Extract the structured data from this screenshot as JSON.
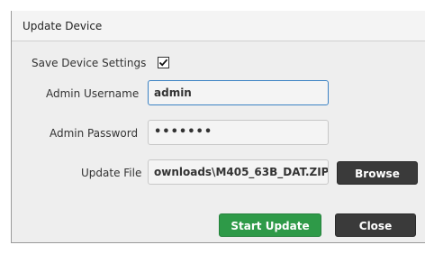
{
  "dialog": {
    "title": "Update Device",
    "save_settings": {
      "label": "Save Device Settings",
      "checked": true
    },
    "username": {
      "label": "Admin Username",
      "value": "admin"
    },
    "password": {
      "label": "Admin Password",
      "value": "•••••••"
    },
    "update_file": {
      "label": "Update File",
      "value": "ownloads\\M405_63B_DAT.ZIP"
    },
    "buttons": {
      "browse": "Browse",
      "start_update": "Start Update",
      "close": "Close"
    }
  }
}
